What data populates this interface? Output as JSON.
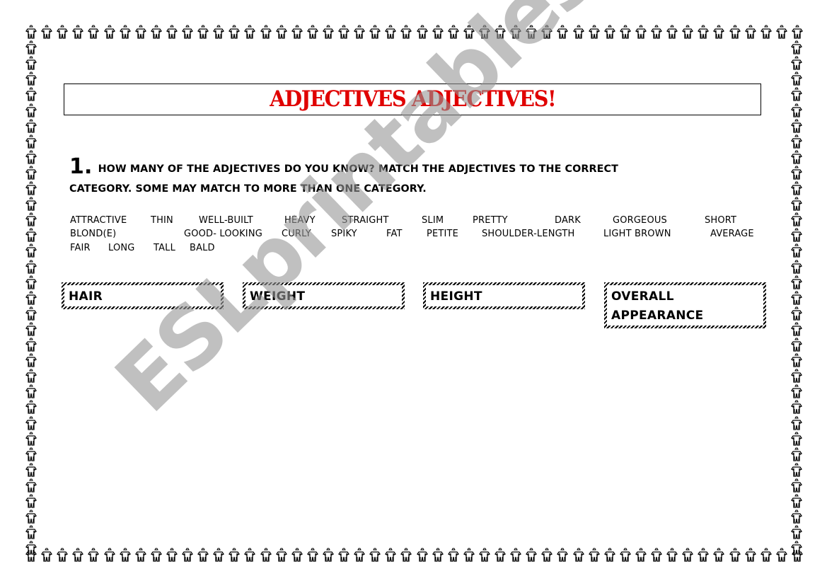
{
  "worksheet": {
    "title": "ADJECTIVES ADJECTIVES!",
    "title_color": "#e00000",
    "question_number": "1.",
    "instructions_line1": "HOW MANY OF THE ADJECTIVES DO YOU KNOW? MATCH THE ADJECTIVES TO THE CORRECT",
    "instructions_line2": "CATEGORY.  SOME MAY MATCH TO MORE THAN ONE CATEGORY.",
    "word_bank": {
      "row1": [
        "ATTRACTIVE",
        "THIN",
        "WELL-BUILT",
        "HEAVY",
        "STRAIGHT",
        "SLIM",
        "PRETTY",
        "DARK",
        "GORGEOUS",
        "SHORT"
      ],
      "row2": [
        "BLOND(E)",
        "GOOD- LOOKING",
        "CURLY",
        "SPIKY",
        "FAT",
        "PETITE",
        "SHOULDER-LENGTH",
        "LIGHT BROWN",
        "AVERAGE"
      ],
      "row3": [
        "FAIR",
        "LONG",
        "TALL",
        "BALD"
      ]
    },
    "categories": [
      {
        "label": "HAIR"
      },
      {
        "label": "WEIGHT"
      },
      {
        "label": "HEIGHT"
      },
      {
        "label": "OVERALL APPEARANCE",
        "line1": "OVERALL",
        "line2": "APPEARANCE"
      }
    ],
    "border_icon": "person-figure-icon"
  },
  "watermark": {
    "text": "ESLprintables.com",
    "color": "#969696"
  }
}
